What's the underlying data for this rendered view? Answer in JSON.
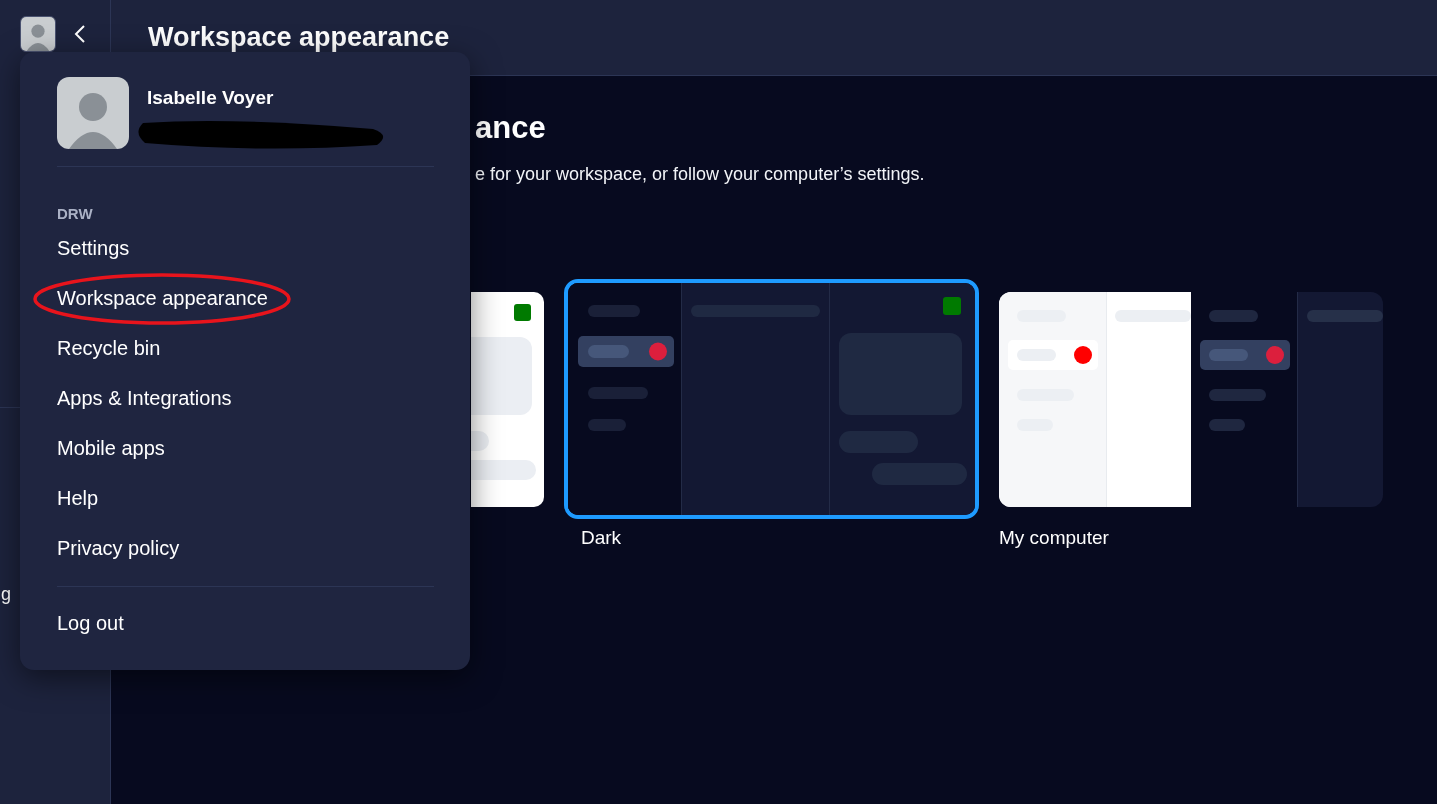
{
  "sidebar": {
    "partial_label": "g"
  },
  "header": {
    "title": "Workspace appearance"
  },
  "content": {
    "title_fragment": "ance",
    "description_fragment": "e for your workspace, or follow your computer’s settings."
  },
  "themes": [
    {
      "kind": "light",
      "selected": false
    },
    {
      "kind": "dark",
      "label": "Dark",
      "selected": true
    },
    {
      "kind": "system",
      "label": "My computer",
      "selected": false
    }
  ],
  "account_menu": {
    "name": "Isabelle Voyer",
    "section": "DRW",
    "items": [
      {
        "label": "Settings",
        "circled": false
      },
      {
        "label": "Workspace appearance",
        "circled": true
      },
      {
        "label": "Recycle bin",
        "circled": false
      },
      {
        "label": "Apps & Integrations",
        "circled": false
      },
      {
        "label": "Mobile apps",
        "circled": false
      },
      {
        "label": "Help",
        "circled": false
      },
      {
        "label": "Privacy policy",
        "circled": false
      }
    ],
    "footer_item": "Log out"
  }
}
